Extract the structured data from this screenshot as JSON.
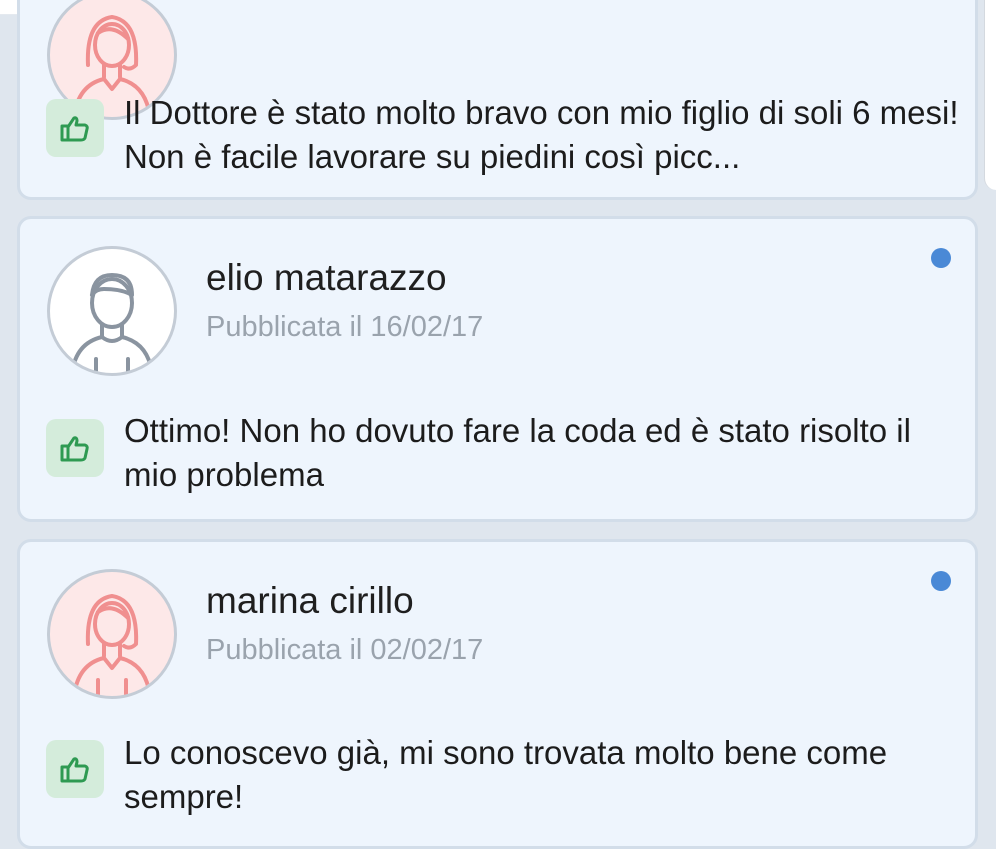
{
  "reviews": [
    {
      "author": "",
      "date": "",
      "avatar": "female-avatar",
      "text": "Il Dottore è stato molto bravo con mio figlio di soli 6 mesi! Non è facile lavorare su piedini così picc...",
      "unread": false
    },
    {
      "author": "elio matarazzo",
      "date": "Pubblicata il 16/02/17",
      "avatar": "male-avatar",
      "text": "Ottimo! Non ho dovuto fare la coda ed è stato risolto il mio problema",
      "unread": true
    },
    {
      "author": "marina cirillo",
      "date": "Pubblicata il 02/02/17",
      "avatar": "female-avatar",
      "text": "Lo conoscevo già, mi sono trovata molto bene come sempre!",
      "unread": true
    }
  ],
  "icons": {
    "like": "thumbs-up-icon",
    "unread": "unread-dot"
  },
  "colors": {
    "card_background": "#eef5fd",
    "card_border": "#d2dde9",
    "like_badge": "#d4ecdb",
    "like_icon": "#2e9a52",
    "unread_dot": "#4a89d6",
    "date_text": "#9aa3ad",
    "female_avatar": "#f08f8f",
    "male_avatar": "#8a94a0"
  }
}
